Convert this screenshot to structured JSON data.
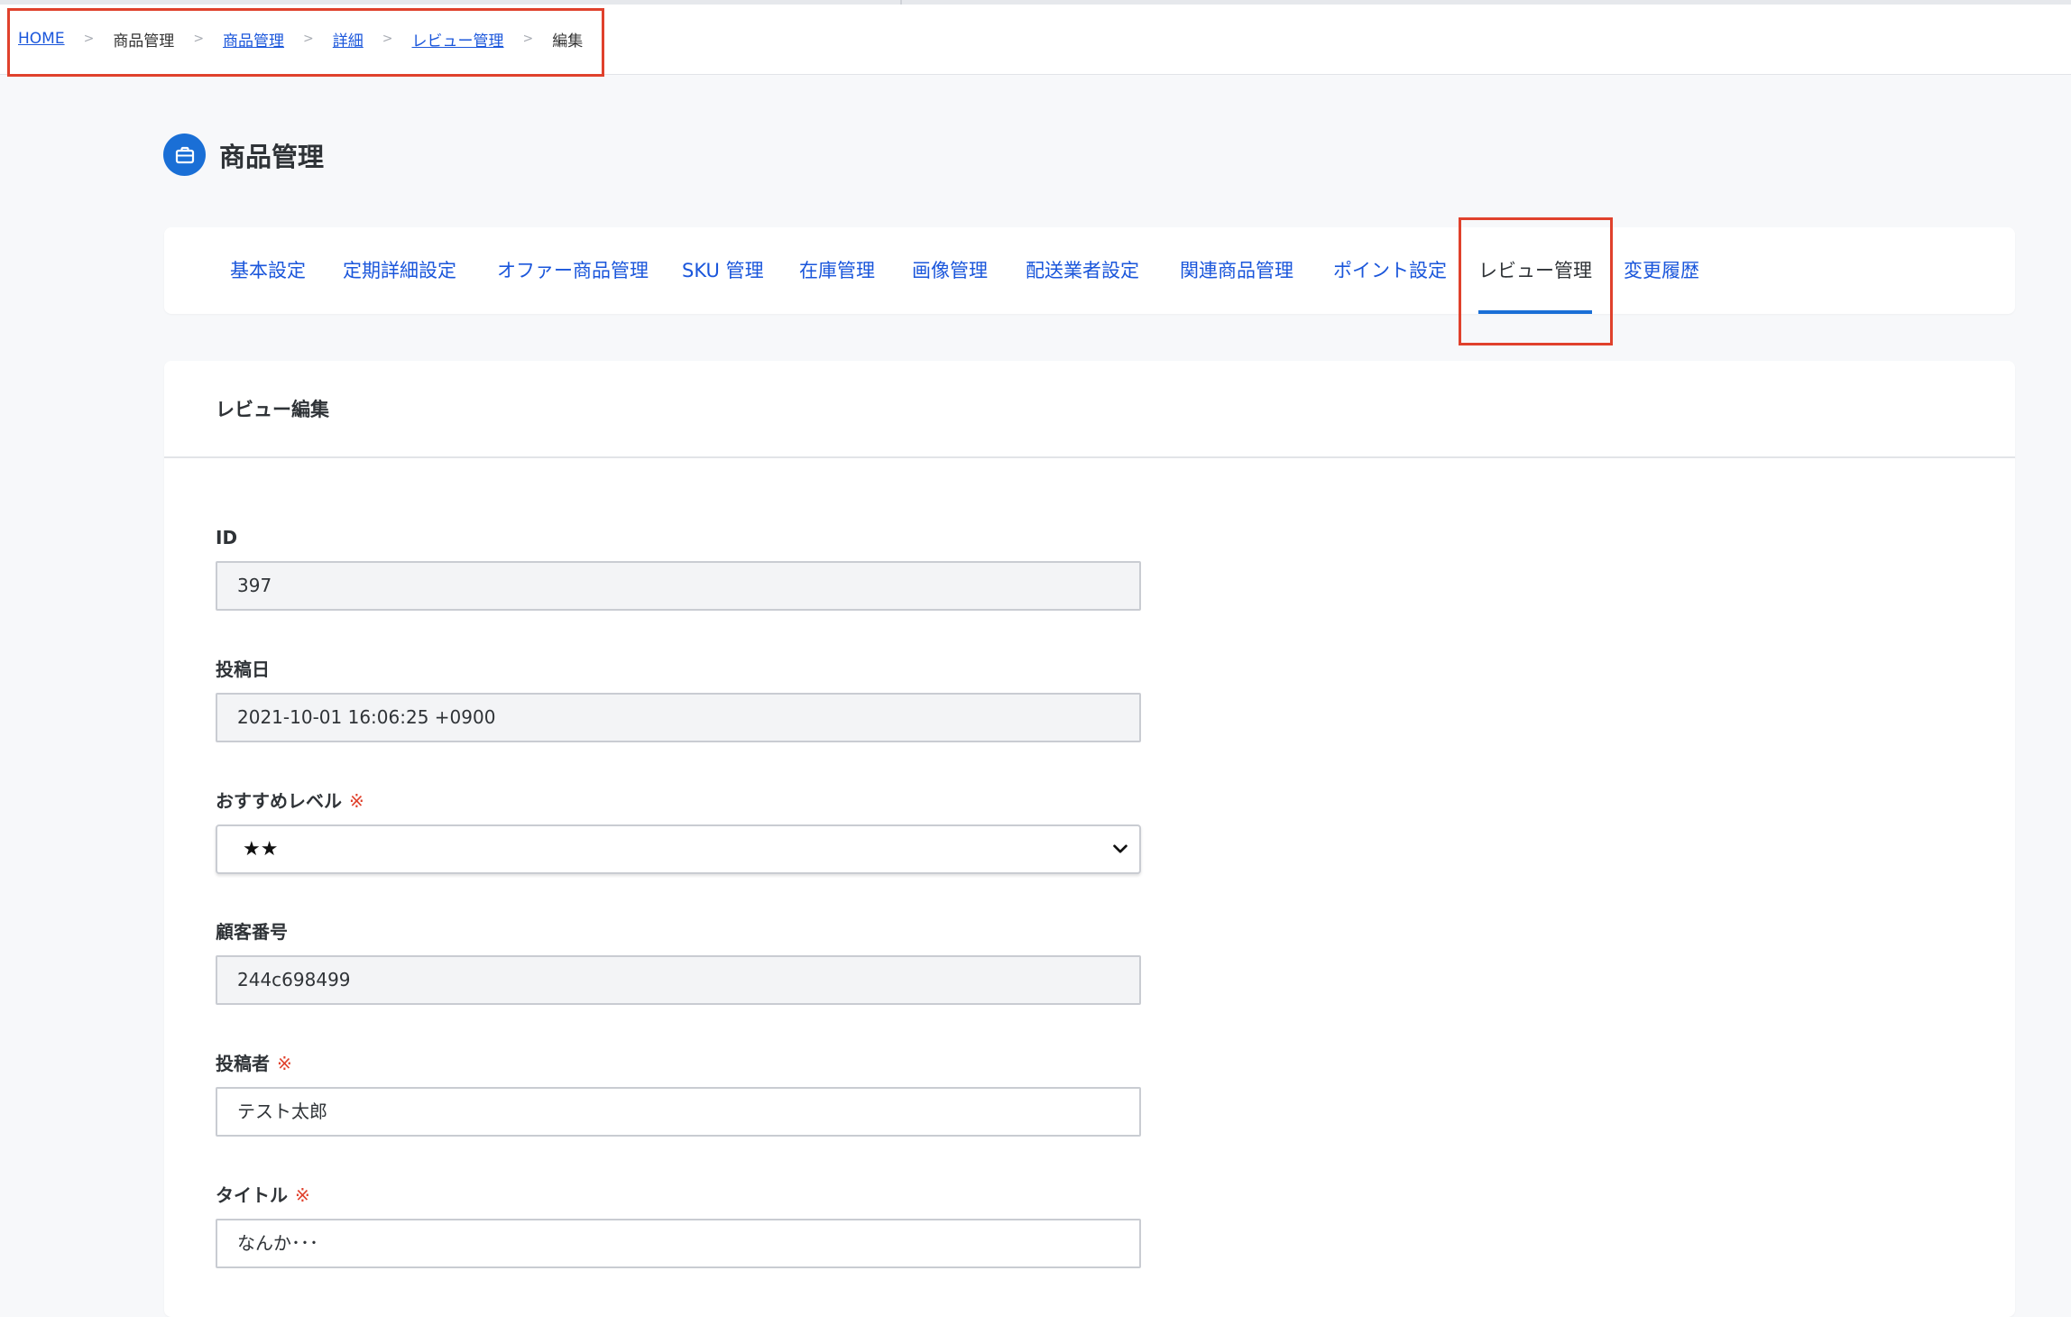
{
  "breadcrumb": {
    "items": [
      {
        "label": "HOME",
        "link": true
      },
      {
        "label": "商品管理",
        "link": false
      },
      {
        "label": "商品管理",
        "link": true
      },
      {
        "label": "詳細",
        "link": true
      },
      {
        "label": "レビュー管理",
        "link": true
      },
      {
        "label": "編集",
        "link": false
      }
    ],
    "separator": ">"
  },
  "page": {
    "title": "商品管理",
    "icon": "briefcase-icon"
  },
  "tabs": [
    {
      "label": "基本設定"
    },
    {
      "label": "定期詳細設定"
    },
    {
      "label": "オファー商品管理"
    },
    {
      "label": "SKU 管理"
    },
    {
      "label": "在庫管理"
    },
    {
      "label": "画像管理"
    },
    {
      "label": "配送業者設定"
    },
    {
      "label": "関連商品管理"
    },
    {
      "label": "ポイント設定"
    },
    {
      "label": "レビュー管理",
      "active": true
    },
    {
      "label": "変更履歴"
    }
  ],
  "form": {
    "header": "レビュー編集",
    "required_mark": "※",
    "fields": {
      "id": {
        "label": "ID",
        "value": "397",
        "readonly": true
      },
      "posted_at": {
        "label": "投稿日",
        "value": "2021-10-01 16:06:25 +0900",
        "readonly": true
      },
      "recommend_level": {
        "label": "おすすめレベル",
        "value": "★★",
        "required": true
      },
      "customer_number": {
        "label": "顧客番号",
        "value": "244c698499",
        "readonly": true
      },
      "poster": {
        "label": "投稿者",
        "value": "テスト太郎",
        "required": true
      },
      "title": {
        "label": "タイトル",
        "value": "なんか･･･",
        "required": true
      }
    }
  },
  "colors": {
    "accent": "#1a6fd6",
    "link": "#1a56db",
    "highlight": "#e0412c",
    "page_bg": "#f7f8fa"
  }
}
